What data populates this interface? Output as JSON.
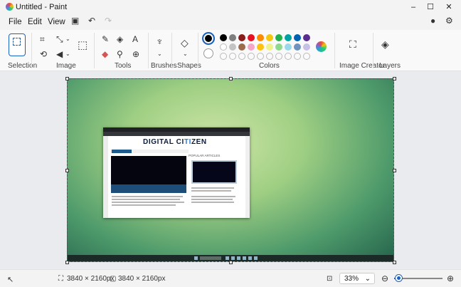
{
  "window": {
    "title": "Untitled - Paint",
    "minimize": "–",
    "maximize": "☐",
    "close": "✕"
  },
  "menu": {
    "file": "File",
    "edit": "Edit",
    "view": "View"
  },
  "ribbon": {
    "groups": {
      "selection": "Selection",
      "image": "Image",
      "tools": "Tools",
      "brushes": "Brushes",
      "shapes": "Shapes",
      "colors": "Colors",
      "image_creator": "Image Creator",
      "layers": "Layers"
    },
    "palette_row1": [
      "#000000",
      "#7f7f7f",
      "#8a1c1c",
      "#e81123",
      "#ff8c00",
      "#f2c811",
      "#22b14c",
      "#00a3a3",
      "#0063b1",
      "#5a2e8f"
    ],
    "palette_row2": [
      "#ffffff",
      "#c3c3c3",
      "#9c6b4e",
      "#f4a6c8",
      "#ffc20e",
      "#eff38b",
      "#8fd98f",
      "#99d9ea",
      "#7092be",
      "#c8bfe7"
    ],
    "current_primary": "#000000",
    "current_secondary": "#ffffff"
  },
  "canvas_content": {
    "site_name_a": "DIGITAL CI",
    "site_name_b": "TI",
    "site_name_c": "ZEN",
    "popular": "POPULAR ARTICLES"
  },
  "status": {
    "canvas_size": "3840 × 2160px",
    "image_size": "3840 × 2160px",
    "zoom": "33%",
    "zoom_fraction": 0.33
  }
}
